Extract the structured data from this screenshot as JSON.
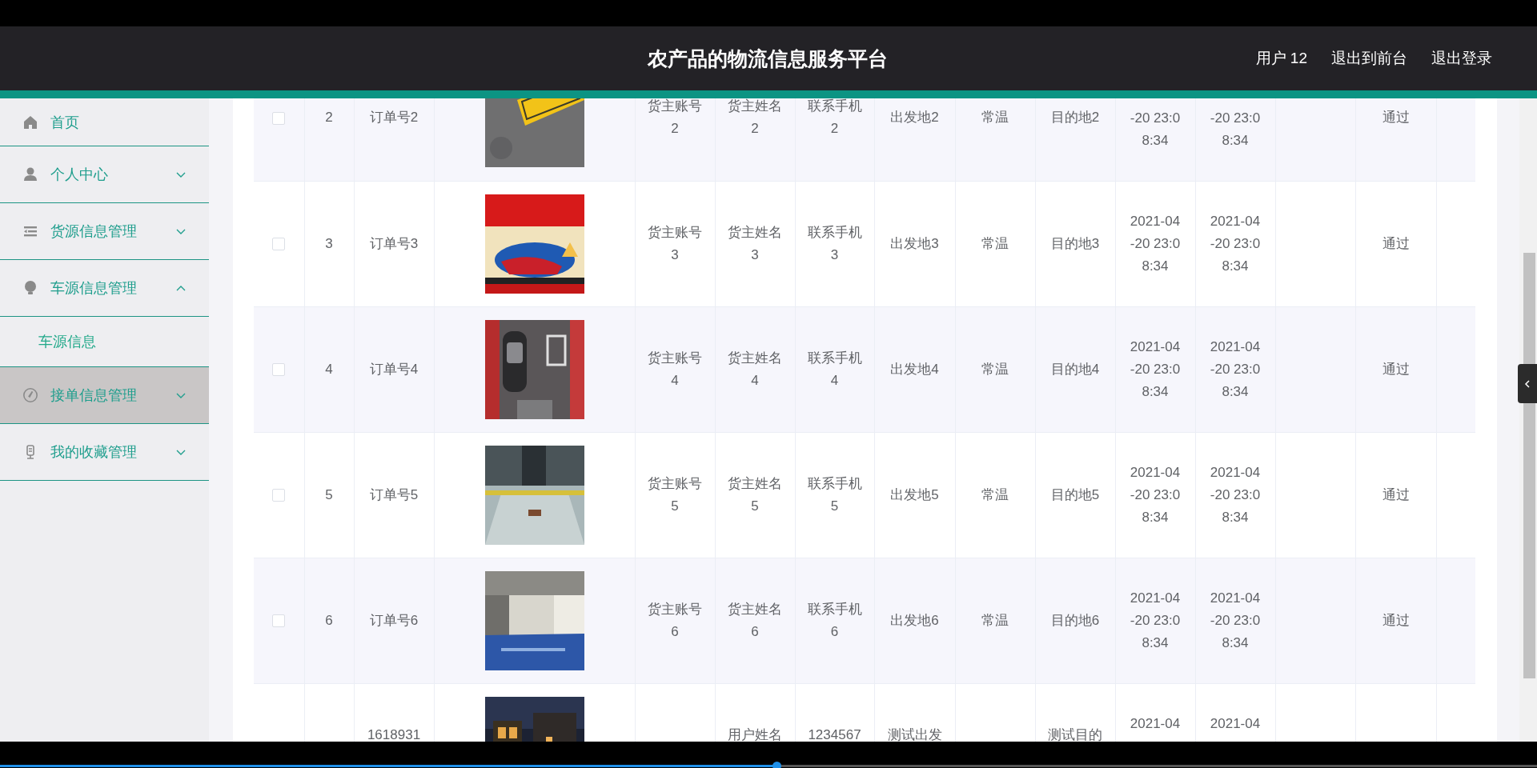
{
  "header": {
    "title": "农产品的物流信息服务平台",
    "links": [
      "用户 12",
      "退出到前台",
      "退出登录"
    ]
  },
  "sidebar": {
    "items": [
      {
        "label": "首页",
        "kind": "link",
        "hovered": false
      },
      {
        "label": "个人中心",
        "kind": "menu",
        "expanded": false,
        "hovered": false
      },
      {
        "label": "货源信息管理",
        "kind": "menu",
        "expanded": false,
        "hovered": false
      },
      {
        "label": "车源信息管理",
        "kind": "menu",
        "expanded": true,
        "hovered": false,
        "children": [
          {
            "label": "车源信息"
          }
        ]
      },
      {
        "label": "接单信息管理",
        "kind": "menu",
        "expanded": false,
        "hovered": true
      },
      {
        "label": "我的收藏管理",
        "kind": "menu",
        "expanded": false,
        "hovered": false
      }
    ]
  },
  "table": {
    "rows": [
      {
        "checked": false,
        "cells": [
          {
            "kind": "text",
            "lines": [
              "2"
            ]
          },
          {
            "kind": "text",
            "lines": [
              "订单号2"
            ]
          },
          {
            "kind": "picture"
          },
          {
            "kind": "text",
            "lines": [
              "货主账号",
              "2"
            ]
          },
          {
            "kind": "text",
            "lines": [
              "货主姓名",
              "2"
            ]
          },
          {
            "kind": "text",
            "lines": [
              "联系手机",
              "2"
            ]
          },
          {
            "kind": "text",
            "lines": [
              "出发地2"
            ]
          },
          {
            "kind": "text",
            "lines": [
              "常温"
            ]
          },
          {
            "kind": "text",
            "lines": [
              "目的地2"
            ]
          },
          {
            "kind": "tail",
            "lines": [
              "-20 23:0",
              "8:34"
            ]
          },
          {
            "kind": "tail",
            "lines": [
              "-20 23:0",
              "8:34"
            ]
          },
          {
            "kind": "empty"
          },
          {
            "kind": "text",
            "lines": [
              "通过"
            ]
          },
          {
            "kind": "empty"
          }
        ]
      },
      {
        "checked": false,
        "cells": [
          {
            "kind": "text",
            "lines": [
              "3"
            ]
          },
          {
            "kind": "text",
            "lines": [
              "订单号3"
            ]
          },
          {
            "kind": "picture"
          },
          {
            "kind": "text",
            "lines": [
              "货主账号",
              "3"
            ]
          },
          {
            "kind": "text",
            "lines": [
              "货主姓名",
              "3"
            ]
          },
          {
            "kind": "text",
            "lines": [
              "联系手机",
              "3"
            ]
          },
          {
            "kind": "text",
            "lines": [
              "出发地3"
            ]
          },
          {
            "kind": "text",
            "lines": [
              "常温"
            ]
          },
          {
            "kind": "text",
            "lines": [
              "目的地3"
            ]
          },
          {
            "kind": "text",
            "lines": [
              "2021-04",
              "-20 23:0",
              "8:34"
            ]
          },
          {
            "kind": "text",
            "lines": [
              "2021-04",
              "-20 23:0",
              "8:34"
            ]
          },
          {
            "kind": "empty"
          },
          {
            "kind": "text",
            "lines": [
              "通过"
            ]
          },
          {
            "kind": "empty"
          }
        ]
      },
      {
        "checked": false,
        "cells": [
          {
            "kind": "text",
            "lines": [
              "4"
            ]
          },
          {
            "kind": "text",
            "lines": [
              "订单号4"
            ]
          },
          {
            "kind": "picture"
          },
          {
            "kind": "text",
            "lines": [
              "货主账号",
              "4"
            ]
          },
          {
            "kind": "text",
            "lines": [
              "货主姓名",
              "4"
            ]
          },
          {
            "kind": "text",
            "lines": [
              "联系手机",
              "4"
            ]
          },
          {
            "kind": "text",
            "lines": [
              "出发地4"
            ]
          },
          {
            "kind": "text",
            "lines": [
              "常温"
            ]
          },
          {
            "kind": "text",
            "lines": [
              "目的地4"
            ]
          },
          {
            "kind": "text",
            "lines": [
              "2021-04",
              "-20 23:0",
              "8:34"
            ]
          },
          {
            "kind": "text",
            "lines": [
              "2021-04",
              "-20 23:0",
              "8:34"
            ]
          },
          {
            "kind": "empty"
          },
          {
            "kind": "text",
            "lines": [
              "通过"
            ]
          },
          {
            "kind": "empty"
          }
        ]
      },
      {
        "checked": false,
        "cells": [
          {
            "kind": "text",
            "lines": [
              "5"
            ]
          },
          {
            "kind": "text",
            "lines": [
              "订单号5"
            ]
          },
          {
            "kind": "picture"
          },
          {
            "kind": "text",
            "lines": [
              "货主账号",
              "5"
            ]
          },
          {
            "kind": "text",
            "lines": [
              "货主姓名",
              "5"
            ]
          },
          {
            "kind": "text",
            "lines": [
              "联系手机",
              "5"
            ]
          },
          {
            "kind": "text",
            "lines": [
              "出发地5"
            ]
          },
          {
            "kind": "text",
            "lines": [
              "常温"
            ]
          },
          {
            "kind": "text",
            "lines": [
              "目的地5"
            ]
          },
          {
            "kind": "text",
            "lines": [
              "2021-04",
              "-20 23:0",
              "8:34"
            ]
          },
          {
            "kind": "text",
            "lines": [
              "2021-04",
              "-20 23:0",
              "8:34"
            ]
          },
          {
            "kind": "empty"
          },
          {
            "kind": "text",
            "lines": [
              "通过"
            ]
          },
          {
            "kind": "empty"
          }
        ]
      },
      {
        "checked": false,
        "cells": [
          {
            "kind": "text",
            "lines": [
              "6"
            ]
          },
          {
            "kind": "text",
            "lines": [
              "订单号6"
            ]
          },
          {
            "kind": "picture"
          },
          {
            "kind": "text",
            "lines": [
              "货主账号",
              "6"
            ]
          },
          {
            "kind": "text",
            "lines": [
              "货主姓名",
              "6"
            ]
          },
          {
            "kind": "text",
            "lines": [
              "联系手机",
              "6"
            ]
          },
          {
            "kind": "text",
            "lines": [
              "出发地6"
            ]
          },
          {
            "kind": "text",
            "lines": [
              "常温"
            ]
          },
          {
            "kind": "text",
            "lines": [
              "目的地6"
            ]
          },
          {
            "kind": "text",
            "lines": [
              "2021-04",
              "-20 23:0",
              "8:34"
            ]
          },
          {
            "kind": "text",
            "lines": [
              "2021-04",
              "-20 23:0",
              "8:34"
            ]
          },
          {
            "kind": "empty"
          },
          {
            "kind": "text",
            "lines": [
              "通过"
            ]
          },
          {
            "kind": "empty"
          }
        ]
      },
      {
        "cells": [
          {
            "kind": "empty"
          },
          {
            "kind": "head",
            "lines": [
              "1618931"
            ]
          },
          {
            "kind": "picture"
          },
          {
            "kind": "empty"
          },
          {
            "kind": "head",
            "lines": [
              "用户姓名"
            ]
          },
          {
            "kind": "head",
            "lines": [
              "1234567"
            ]
          },
          {
            "kind": "head",
            "lines": [
              "测试出发"
            ]
          },
          {
            "kind": "empty"
          },
          {
            "kind": "head",
            "lines": [
              "测试目的"
            ]
          },
          {
            "kind": "head",
            "lines": [
              "2021-04"
            ]
          },
          {
            "kind": "head",
            "lines": [
              "2021-04"
            ]
          },
          {
            "kind": "empty"
          },
          {
            "kind": "empty"
          },
          {
            "kind": "empty"
          }
        ]
      }
    ]
  },
  "player": {
    "level": 0.505
  }
}
